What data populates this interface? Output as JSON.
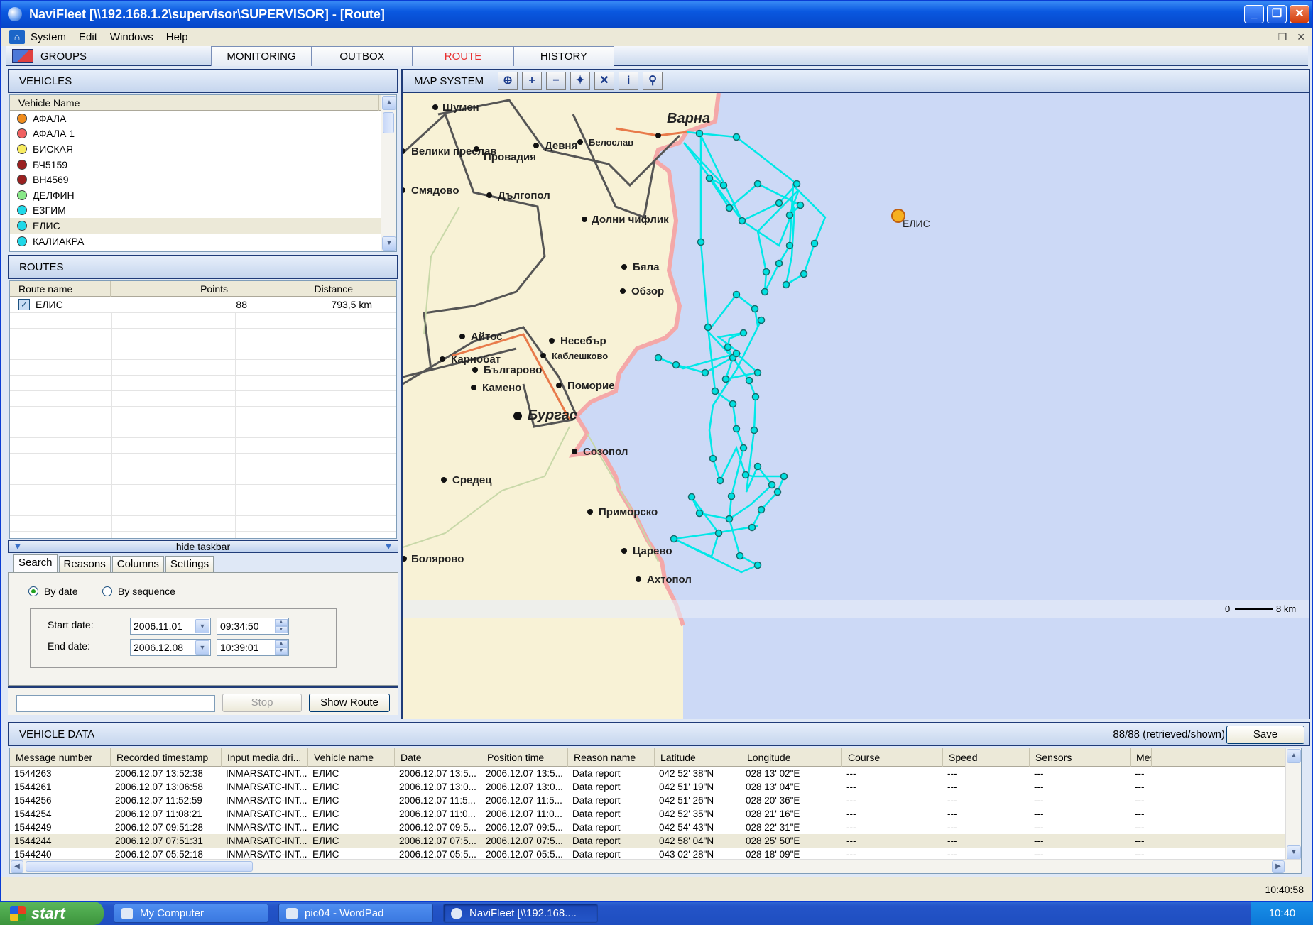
{
  "window": {
    "title": "NaviFleet [\\\\192.168.1.2\\supervisor\\SUPERVISOR] - [Route]"
  },
  "menu": {
    "items": [
      "System",
      "Edit",
      "Windows",
      "Help"
    ]
  },
  "tabs": {
    "groups": "GROUPS",
    "items": [
      "MONITORING",
      "OUTBOX",
      "ROUTE",
      "HISTORY"
    ],
    "active": "ROUTE"
  },
  "vehicles": {
    "title": "VEHICLES",
    "column": "Vehicle Name",
    "items": [
      {
        "name": "АФАЛА",
        "color": "#f08c1c"
      },
      {
        "name": "АФАЛА 1",
        "color": "#f06060"
      },
      {
        "name": "БИСКАЯ",
        "color": "#f8ec60"
      },
      {
        "name": "БЧ5159",
        "color": "#9a2020"
      },
      {
        "name": "ВН4569",
        "color": "#9a2020"
      },
      {
        "name": "ДЕЛФИН",
        "color": "#88e888"
      },
      {
        "name": "ЕЗГИМ",
        "color": "#20d8e8"
      },
      {
        "name": "ЕЛИС",
        "color": "#20d8e8",
        "selected": true
      },
      {
        "name": "КАЛИАКРА",
        "color": "#20d8e8"
      }
    ]
  },
  "routes": {
    "title": "ROUTES",
    "columns": [
      "Route name",
      "Points",
      "Distance"
    ],
    "rows": [
      {
        "name": "ЕЛИС",
        "points": "88",
        "distance": "793,5 km",
        "checked": true
      }
    ]
  },
  "taskbar_toggle": "hide taskbar",
  "search": {
    "tabs": [
      "Search",
      "Reasons",
      "Columns",
      "Settings"
    ],
    "by_date": "By date",
    "by_sequence": "By sequence",
    "start_label": "Start date:",
    "start_date": "2006.11.01",
    "start_time": "09:34:50",
    "end_label": "End date:",
    "end_date": "2006.12.08",
    "end_time": "10:39:01",
    "stop": "Stop",
    "show_route": "Show Route"
  },
  "map": {
    "title": "MAP SYSTEM",
    "tools": [
      "zoom-window-icon",
      "zoom-in-icon",
      "zoom-out-icon",
      "center-icon",
      "fit-icon",
      "info-icon",
      "ruler-icon"
    ],
    "vehicle_label": "ЕЛИС",
    "scale_zero": "0",
    "scale_label": "8 km",
    "route_color": "#00e8e8",
    "sea_color": "#ccd9f6",
    "land_color": "#f8f2d6",
    "places": [
      "Шумен",
      "Варна",
      "Велики преслав",
      "Провадия",
      "Девня",
      "Белослав",
      "Смядово",
      "Дългопол",
      "Долни чифлик",
      "Бяла",
      "Обзор",
      "Айтос",
      "Несебър",
      "Карнобат",
      "Каблешково",
      "Българово",
      "Поморие",
      "Камено",
      "Бургас",
      "Созопол",
      "Средец",
      "Приморско",
      "Царево",
      "Болярово",
      "Ахтопол"
    ]
  },
  "vehicle_data": {
    "title": "VEHICLE DATA",
    "count": "88/88 (retrieved/shown)",
    "save": "Save",
    "columns": [
      "Message number",
      "Recorded timestamp",
      "Input media dri...",
      "Vehicle name",
      "Date",
      "Position time",
      "Reason name",
      "Latitude",
      "Longitude",
      "Course",
      "Speed",
      "Sensors",
      "Mes"
    ],
    "rows": [
      [
        "1544263",
        "2006.12.07 13:52:38",
        "INMARSATC-INT...",
        "ЕЛИС",
        "2006.12.07 13:5...",
        "2006.12.07 13:5...",
        "Data report",
        "042 52' 38\"N",
        "028 13' 02\"E",
        "---",
        "---",
        "---",
        "---"
      ],
      [
        "1544261",
        "2006.12.07 13:06:58",
        "INMARSATC-INT...",
        "ЕЛИС",
        "2006.12.07 13:0...",
        "2006.12.07 13:0...",
        "Data report",
        "042 51' 19\"N",
        "028 13' 04\"E",
        "---",
        "---",
        "---",
        "---"
      ],
      [
        "1544256",
        "2006.12.07 11:52:59",
        "INMARSATC-INT...",
        "ЕЛИС",
        "2006.12.07 11:5...",
        "2006.12.07 11:5...",
        "Data report",
        "042 51' 26\"N",
        "028 20' 36\"E",
        "---",
        "---",
        "---",
        "---"
      ],
      [
        "1544254",
        "2006.12.07 11:08:21",
        "INMARSATC-INT...",
        "ЕЛИС",
        "2006.12.07 11:0...",
        "2006.12.07 11:0...",
        "Data report",
        "042 52' 35\"N",
        "028 21' 16\"E",
        "---",
        "---",
        "---",
        "---"
      ],
      [
        "1544249",
        "2006.12.07 09:51:28",
        "INMARSATC-INT...",
        "ЕЛИС",
        "2006.12.07 09:5...",
        "2006.12.07 09:5...",
        "Data report",
        "042 54' 43\"N",
        "028 22' 31\"E",
        "---",
        "---",
        "---",
        "---"
      ],
      [
        "1544244",
        "2006.12.07 07:51:31",
        "INMARSATC-INT...",
        "ЕЛИС",
        "2006.12.07 07:5...",
        "2006.12.07 07:5...",
        "Data report",
        "042 58' 04\"N",
        "028 25' 50\"E",
        "---",
        "---",
        "---",
        "---"
      ],
      [
        "1544240",
        "2006.12.07 05:52:18",
        "INMARSATC-INT...",
        "ЕЛИС",
        "2006.12.07 05:5...",
        "2006.12.07 05:5...",
        "Data report",
        "043 02' 28\"N",
        "028 18' 09\"E",
        "---",
        "---",
        "---",
        "---"
      ]
    ],
    "selected_row": 5
  },
  "status": {
    "time": "10:40:58"
  },
  "os_taskbar": {
    "start": "start",
    "tasks": [
      "My Computer",
      "pic04 - WordPad",
      "NaviFleet [\\\\192.168...."
    ],
    "clock": "10:40"
  }
}
